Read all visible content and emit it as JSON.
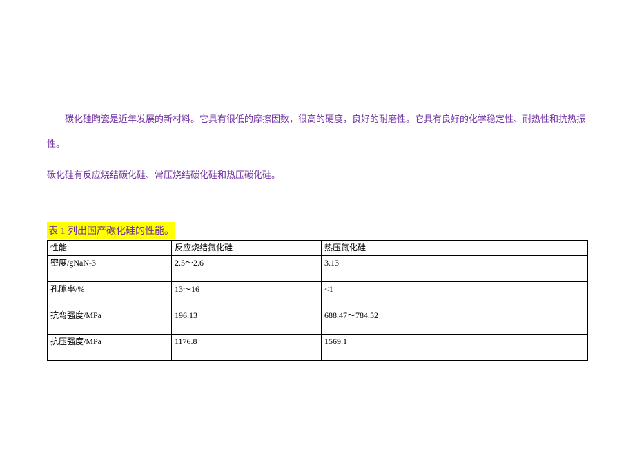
{
  "paragraphs": {
    "p1": "碳化硅陶瓷是近年发展的新材料。它具有很低的摩擦因数，很高的硬度，良好的耐磨性。它具有良好的化学稳定性、耐热性和抗热振性。",
    "p2": "碳化硅有反应烧结碳化硅、常压烧结碳化硅和热压碳化硅。"
  },
  "table_caption": "表 1 列出国产碳化硅的性能。",
  "chart_data": {
    "type": "table",
    "columns": [
      "性能",
      "反应烧结氮化硅",
      "热压氮化硅"
    ],
    "rows": [
      {
        "prop": "密度/gNaN-3",
        "reaction": "2.5～2.6",
        "hotpress": "3.13"
      },
      {
        "prop": "孔隙率/%",
        "reaction": "13～16",
        "hotpress": "<1"
      },
      {
        "prop": "抗弯强度/MPa",
        "reaction": "196.13",
        "hotpress": "688.47～784.52"
      },
      {
        "prop": "抗压强度/MPa",
        "reaction": "1176.8",
        "hotpress": "1569.1"
      }
    ]
  }
}
